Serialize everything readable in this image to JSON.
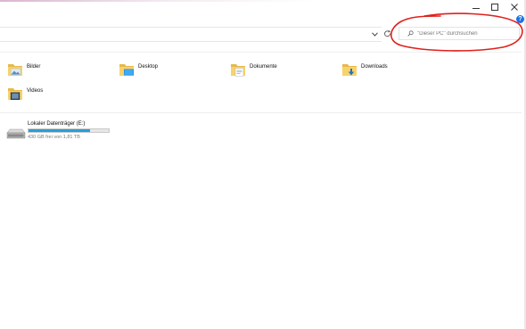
{
  "window": {
    "minimize_glyph": "—",
    "maximize_glyph": "☐",
    "close_glyph": "✕",
    "help_glyph": "?"
  },
  "address": {
    "dropdown_glyph": "⌄",
    "refresh_glyph": "↻"
  },
  "search": {
    "placeholder": "\"Dieser PC\" durchsuchen"
  },
  "folders": [
    {
      "label": "Bilder",
      "icon": "pictures-folder-icon"
    },
    {
      "label": "Desktop",
      "icon": "desktop-folder-icon"
    },
    {
      "label": "Dokumente",
      "icon": "documents-folder-icon"
    },
    {
      "label": "Downloads",
      "icon": "downloads-folder-icon"
    },
    {
      "label": "Videos",
      "icon": "videos-folder-icon"
    }
  ],
  "drives": [
    {
      "label": "Lokaler Datenträger (E:)",
      "free_text": "430 GB frei von 1,81 TB",
      "used_fraction": 0.77,
      "bar_color": "#26a0da"
    }
  ],
  "colors": {
    "accent": "#26a0da",
    "annotation": "#e0201b",
    "help": "#1a73e8"
  }
}
